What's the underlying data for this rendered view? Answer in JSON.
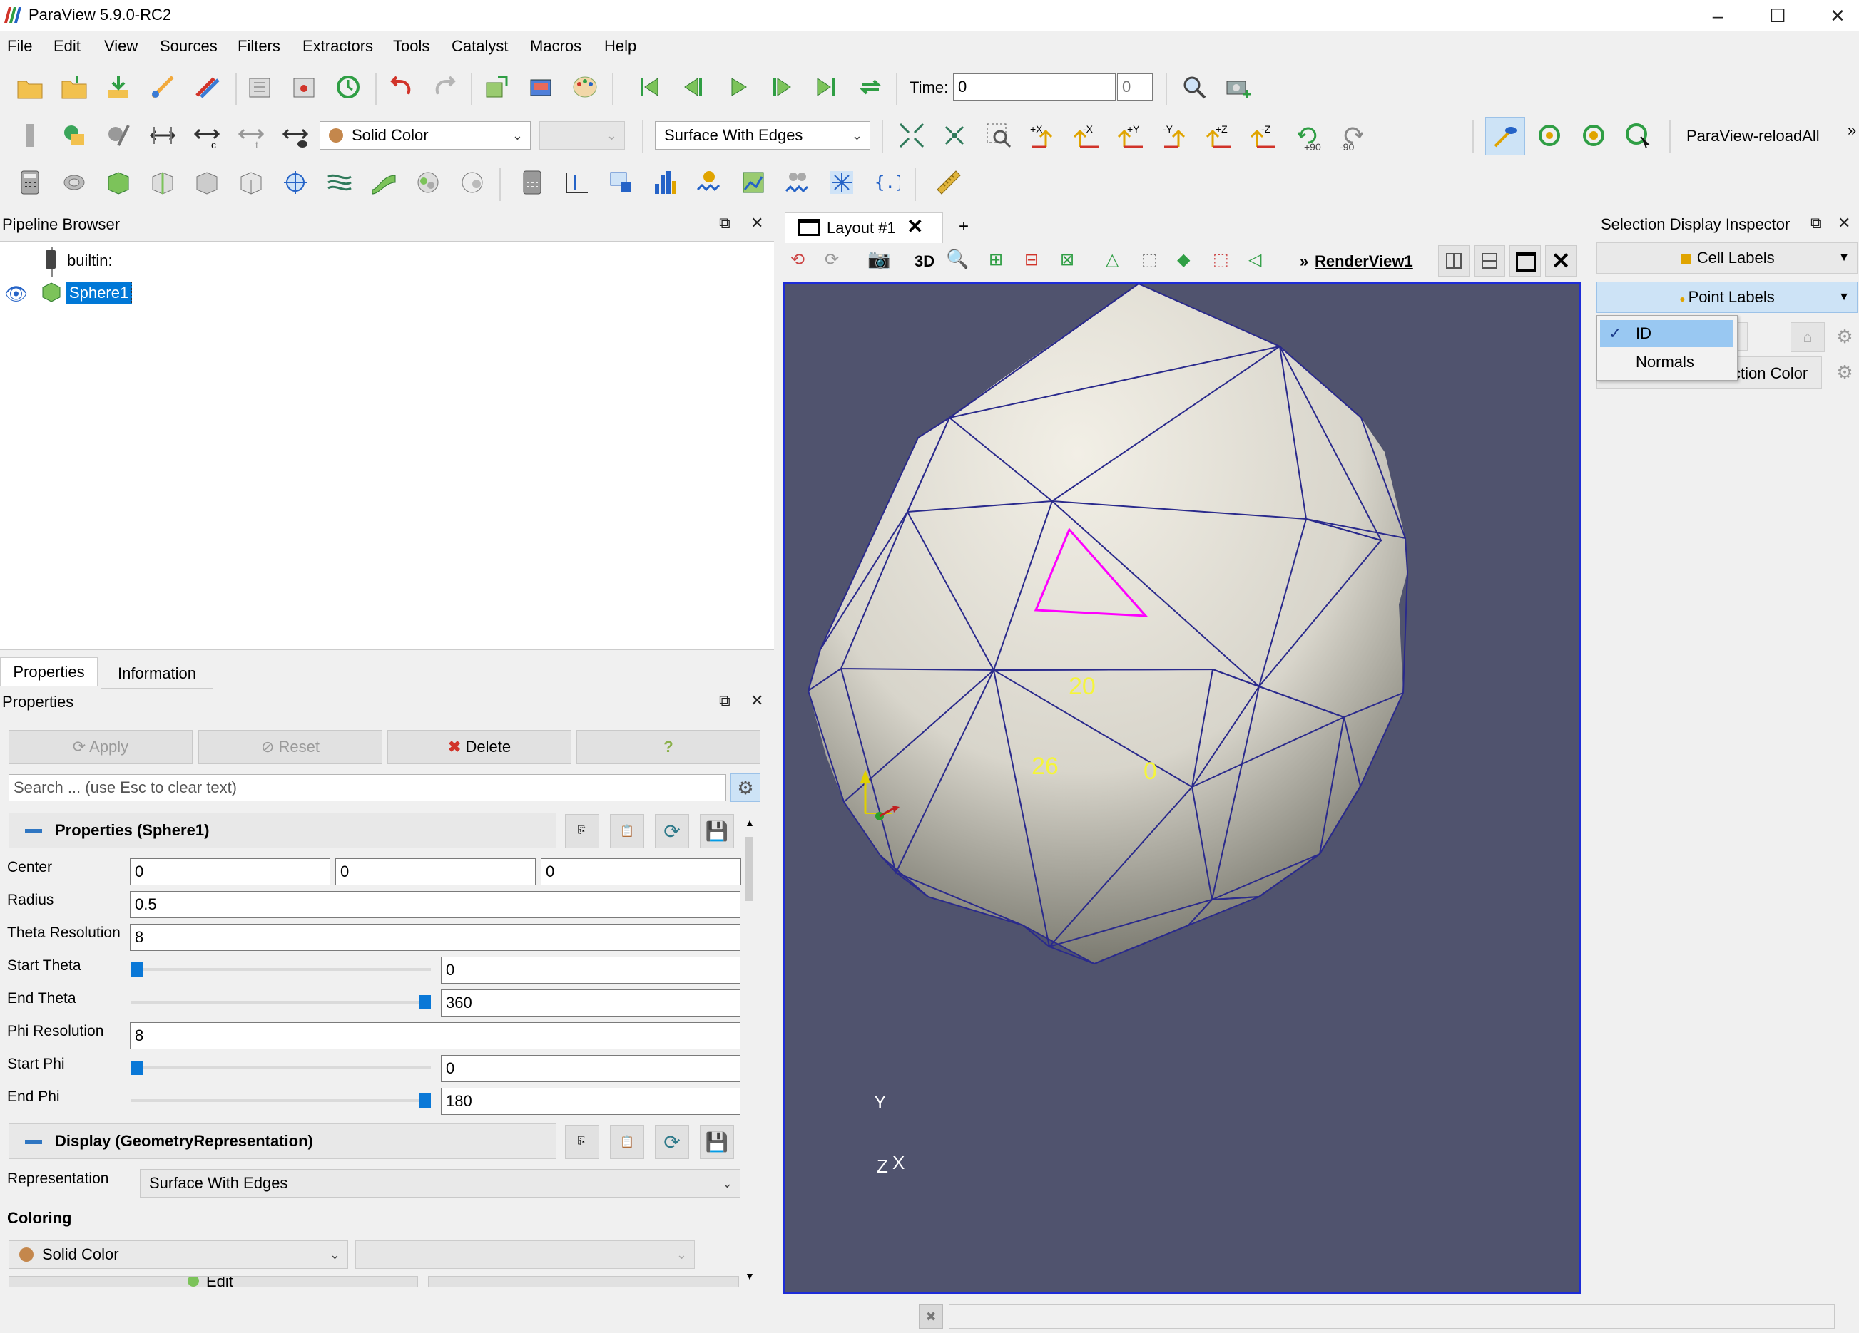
{
  "window": {
    "title": "ParaView 5.9.0-RC2"
  },
  "menu": [
    "File",
    "Edit",
    "View",
    "Sources",
    "Filters",
    "Extractors",
    "Tools",
    "Catalyst",
    "Macros",
    "Help"
  ],
  "toolbar": {
    "time_label": "Time:",
    "time_value": "0",
    "time_index": "0",
    "coloring_combo": "Solid Color",
    "representation_combo": "Surface With Edges",
    "rotate_plus": "+90",
    "rotate_minus": "-90",
    "macro_label": "ParaView-reloadAll",
    "overflow": "»"
  },
  "pipeline": {
    "title": "Pipeline Browser",
    "root": "builtin:",
    "items": [
      {
        "label": "Sphere1",
        "selected": true
      }
    ]
  },
  "tabs": {
    "properties": "Properties",
    "information": "Information"
  },
  "properties_panel": {
    "title": "Properties",
    "apply": "Apply",
    "reset": "Reset",
    "delete": "Delete",
    "help": "?",
    "search_placeholder": "Search ... (use Esc to clear text)",
    "section_title": "Properties (Sphere1)",
    "center_label": "Center",
    "center": [
      "0",
      "0",
      "0"
    ],
    "radius_label": "Radius",
    "radius": "0.5",
    "theta_res_label": "Theta Resolution",
    "theta_res": "8",
    "start_theta_label": "Start Theta",
    "start_theta": "0",
    "start_theta_level": 0,
    "end_theta_label": "End Theta",
    "end_theta": "360",
    "end_theta_level": 1,
    "phi_res_label": "Phi Resolution",
    "phi_res": "8",
    "start_phi_label": "Start Phi",
    "start_phi": "0",
    "start_phi_level": 0,
    "end_phi_label": "End Phi",
    "end_phi": "180",
    "end_phi_level": 1,
    "display_title": "Display (GeometryRepresentation)",
    "representation_label": "Representation",
    "representation_value": "Surface With Edges",
    "coloring_heading": "Coloring",
    "coloring_value": "Solid Color",
    "edit_label": "Edit"
  },
  "layout": {
    "tab_label": "Layout #1",
    "add_tab": "+",
    "view_3d": "3D",
    "view_name": "RenderView1",
    "view_name_prefix": "»"
  },
  "render": {
    "background": "#50536e",
    "point_labels": [
      "20",
      "26",
      "0"
    ],
    "axes": {
      "y": "Y",
      "z": "Z",
      "x": "X"
    }
  },
  "inspector": {
    "title": "Selection Display Inspector",
    "cell_labels": "Cell Labels",
    "point_labels": "Point Labels",
    "dropdown_items": [
      {
        "label": "ID",
        "checked": true
      },
      {
        "label": "Normals",
        "checked": false
      }
    ],
    "selection_color": "ction Color"
  },
  "colors": {
    "accent": "#0a78d7",
    "selected_blue": "#0078d7",
    "viewport_border": "#1d2cd8",
    "edges": "#2a2a8c",
    "highlight": "#ff00ff",
    "label_yellow": "#f5f53b",
    "solid_color_swatch": "#c4874c"
  }
}
